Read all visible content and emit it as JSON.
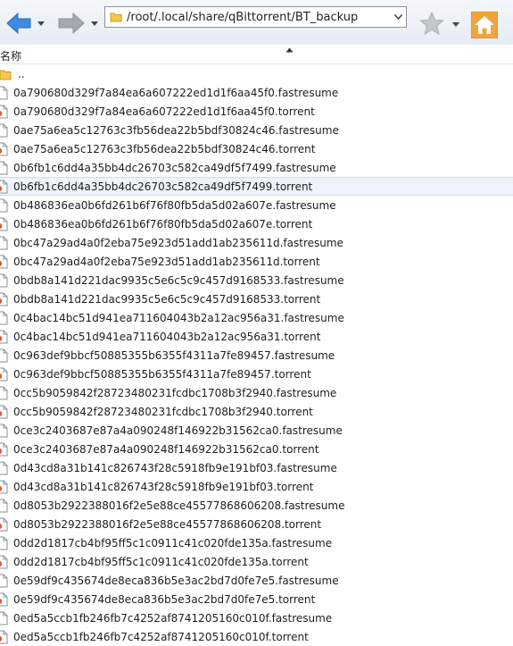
{
  "toolbar": {
    "path": "/root/.local/share/qBittorrent/BT_backup"
  },
  "header": {
    "name_column": "名称"
  },
  "parent_dir": "..",
  "files": [
    {
      "name": "0a790680d329f7a84ea6a607222ed1d1f6aa45f0.fastresume",
      "type": "fastresume"
    },
    {
      "name": "0a790680d329f7a84ea6a607222ed1d1f6aa45f0.torrent",
      "type": "torrent"
    },
    {
      "name": "0ae75a6ea5c12763c3fb56dea22b5bdf30824c46.fastresume",
      "type": "fastresume"
    },
    {
      "name": "0ae75a6ea5c12763c3fb56dea22b5bdf30824c46.torrent",
      "type": "torrent"
    },
    {
      "name": "0b6fb1c6dd4a35bb4dc26703c582ca49df5f7499.fastresume",
      "type": "fastresume"
    },
    {
      "name": "0b6fb1c6dd4a35bb4dc26703c582ca49df5f7499.torrent",
      "type": "torrent",
      "selected": true
    },
    {
      "name": "0b486836ea0b6fd261b6f76f80fb5da5d02a607e.fastresume",
      "type": "fastresume"
    },
    {
      "name": "0b486836ea0b6fd261b6f76f80fb5da5d02a607e.torrent",
      "type": "torrent"
    },
    {
      "name": "0bc47a29ad4a0f2eba75e923d51add1ab235611d.fastresume",
      "type": "fastresume"
    },
    {
      "name": "0bc47a29ad4a0f2eba75e923d51add1ab235611d.torrent",
      "type": "torrent"
    },
    {
      "name": "0bdb8a141d221dac9935c5e6c5c9c457d9168533.fastresume",
      "type": "fastresume"
    },
    {
      "name": "0bdb8a141d221dac9935c5e6c5c9c457d9168533.torrent",
      "type": "torrent"
    },
    {
      "name": "0c4bac14bc51d941ea711604043b2a12ac956a31.fastresume",
      "type": "fastresume"
    },
    {
      "name": "0c4bac14bc51d941ea711604043b2a12ac956a31.torrent",
      "type": "torrent"
    },
    {
      "name": "0c963def9bbcf50885355b6355f4311a7fe89457.fastresume",
      "type": "fastresume"
    },
    {
      "name": "0c963def9bbcf50885355b6355f4311a7fe89457.torrent",
      "type": "torrent"
    },
    {
      "name": "0cc5b9059842f28723480231fcdbc1708b3f2940.fastresume",
      "type": "fastresume"
    },
    {
      "name": "0cc5b9059842f28723480231fcdbc1708b3f2940.torrent",
      "type": "torrent"
    },
    {
      "name": "0ce3c2403687e87a4a090248f146922b31562ca0.fastresume",
      "type": "fastresume"
    },
    {
      "name": "0ce3c2403687e87a4a090248f146922b31562ca0.torrent",
      "type": "torrent"
    },
    {
      "name": "0d43cd8a31b141c826743f28c5918fb9e191bf03.fastresume",
      "type": "fastresume"
    },
    {
      "name": "0d43cd8a31b141c826743f28c5918fb9e191bf03.torrent",
      "type": "torrent"
    },
    {
      "name": "0d8053b2922388016f2e5e88ce45577868606208.fastresume",
      "type": "fastresume"
    },
    {
      "name": "0d8053b2922388016f2e5e88ce45577868606208.torrent",
      "type": "torrent"
    },
    {
      "name": "0dd2d1817cb4bf95ff5c1c0911c41c020fde135a.fastresume",
      "type": "fastresume"
    },
    {
      "name": "0dd2d1817cb4bf95ff5c1c0911c41c020fde135a.torrent",
      "type": "torrent"
    },
    {
      "name": "0e59df9c435674de8eca836b5e3ac2bd7d0fe7e5.fastresume",
      "type": "fastresume"
    },
    {
      "name": "0e59df9c435674de8eca836b5e3ac2bd7d0fe7e5.torrent",
      "type": "torrent"
    },
    {
      "name": "0ed5a5ccb1fb246fb7c4252af8741205160c010f.fastresume",
      "type": "fastresume"
    },
    {
      "name": "0ed5a5ccb1fb246fb7c4252af8741205160c010f.torrent",
      "type": "torrent"
    }
  ],
  "colors": {
    "accent": "#3c7fd6",
    "selection": "#eef4fc",
    "home": "#f0a43a",
    "torrent_badge": "#e05a2b"
  }
}
